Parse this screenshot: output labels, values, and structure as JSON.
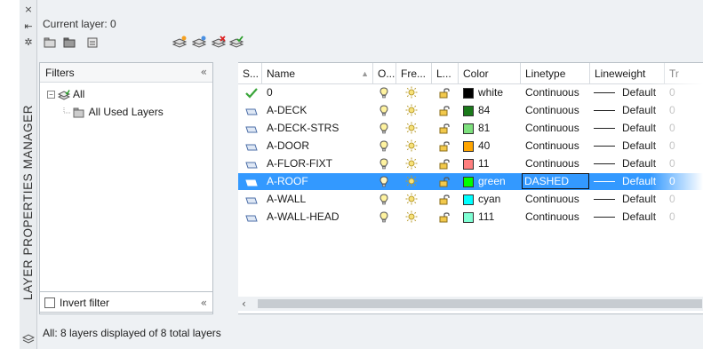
{
  "palette": {
    "title": "LAYER PROPERTIES MANAGER",
    "close_icon": "×",
    "autohide_icon": "⇤",
    "settings_icon": "✲"
  },
  "header": {
    "current_layer": "Current layer: 0"
  },
  "filters": {
    "title": "Filters",
    "collapse_icon": "«",
    "tree": [
      {
        "label": "All",
        "level": 0
      },
      {
        "label": "All Used Layers",
        "level": 1
      }
    ],
    "invert_label": "Invert filter",
    "invert_collapse": "«"
  },
  "columns": [
    "S...",
    "Name",
    "O...",
    "Fre...",
    "L...",
    "Color",
    "Linetype",
    "Lineweight",
    "Tr"
  ],
  "layers": [
    {
      "status": "current",
      "name": "0",
      "color_name": "white",
      "color": "#000000",
      "linetype": "Continuous",
      "lineweight": "Default",
      "trans": "0"
    },
    {
      "status": "layer",
      "name": "A-DECK",
      "color_name": "84",
      "color": "#1a7a1a",
      "linetype": "Continuous",
      "lineweight": "Default",
      "trans": "0"
    },
    {
      "status": "layer",
      "name": "A-DECK-STRS",
      "color_name": "81",
      "color": "#7de07d",
      "linetype": "Continuous",
      "lineweight": "Default",
      "trans": "0"
    },
    {
      "status": "layer",
      "name": "A-DOOR",
      "color_name": "40",
      "color": "#ffa500",
      "linetype": "Continuous",
      "lineweight": "Default",
      "trans": "0"
    },
    {
      "status": "layer",
      "name": "A-FLOR-FIXT",
      "color_name": "11",
      "color": "#ff7f7f",
      "linetype": "Continuous",
      "lineweight": "Default",
      "trans": "0"
    },
    {
      "status": "layer",
      "name": "A-ROOF",
      "color_name": "green",
      "color": "#00ff00",
      "linetype": "DASHED",
      "lineweight": "Default",
      "trans": "0",
      "selected": true
    },
    {
      "status": "layer",
      "name": "A-WALL",
      "color_name": "cyan",
      "color": "#00ffff",
      "linetype": "Continuous",
      "lineweight": "Default",
      "trans": "0"
    },
    {
      "status": "layer",
      "name": "A-WALL-HEAD",
      "color_name": "111",
      "color": "#7fffd4",
      "linetype": "Continuous",
      "lineweight": "Default",
      "trans": "0"
    }
  ],
  "status_bar": "All: 8 layers displayed of 8 total layers"
}
